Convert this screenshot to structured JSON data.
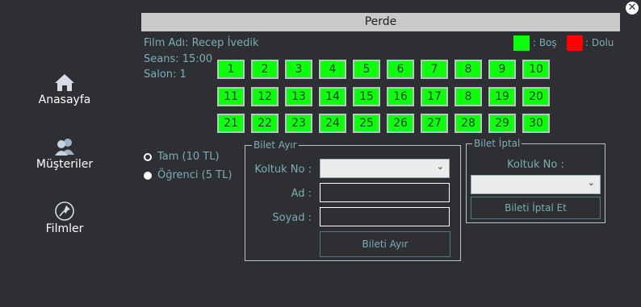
{
  "window": {
    "close_glyph": "✕"
  },
  "nav": {
    "home_label": "Anasayfa",
    "customers_label": "Müşteriler",
    "films_label": "Filmler"
  },
  "screen_label": "Perde",
  "film": {
    "name_text": "Film Adı: Recep İvedik",
    "session_text": "Seans: 15:00",
    "hall_text": "Salon: 1"
  },
  "legend": {
    "free_label": ": Boş",
    "free_color": "#0eff0e",
    "taken_label": ": Dolu",
    "taken_color": "#ff0000"
  },
  "seats": [
    "1",
    "2",
    "3",
    "4",
    "5",
    "6",
    "7",
    "8",
    "9",
    "10",
    "11",
    "12",
    "13",
    "14",
    "15",
    "16",
    "17",
    "8",
    "19",
    "20",
    "21",
    "22",
    "23",
    "24",
    "25",
    "26",
    "27",
    "28",
    "29",
    "30"
  ],
  "ticket_type": {
    "full_label": "Tam (10 TL)",
    "student_label": "Öğrenci (5 TL)",
    "selected": "student"
  },
  "buy": {
    "title": "Bilet Ayır",
    "seat_label": "Koltuk No :",
    "seat_value": "",
    "name_label": "Ad :",
    "name_value": "",
    "surname_label": "Soyad :",
    "surname_value": "",
    "button_label": "Bileti Ayır"
  },
  "cancel": {
    "title": "Bilet İptal",
    "seat_label": "Koltuk No :",
    "seat_value": "",
    "button_label": "Bileti İptal Et"
  }
}
